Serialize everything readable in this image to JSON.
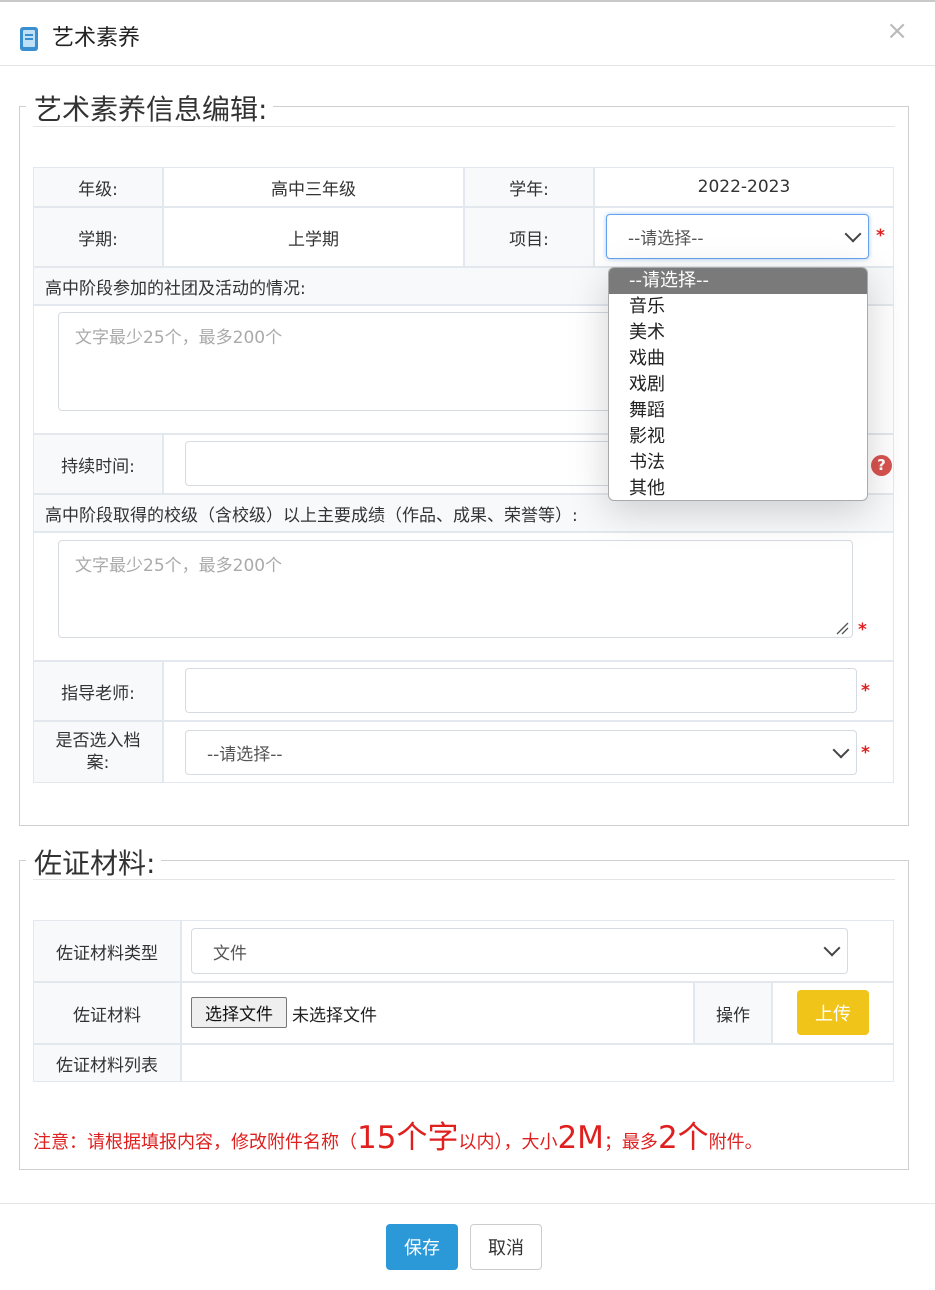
{
  "dialog": {
    "title": "艺术素养",
    "close_label": "×"
  },
  "section1": {
    "legend": "艺术素养信息编辑:",
    "grade_label": "年级:",
    "grade_value": "高中三年级",
    "year_label": "学年:",
    "year_value": "2022-2023",
    "term_label": "学期:",
    "term_value": "上学期",
    "project_label": "项目:",
    "project_selected": "--请选择--",
    "project_options": [
      "--请选择--",
      "音乐",
      "美术",
      "戏曲",
      "戏剧",
      "舞蹈",
      "影视",
      "书法",
      "其他"
    ],
    "activities_label": "高中阶段参加的社团及活动的情况:",
    "activities_placeholder": "文字最少25个，最多200个",
    "duration_label": "持续时间:",
    "achievements_label": "高中阶段取得的校级（含校级）以上主要成绩（作品、成果、荣誉等）:",
    "achievements_placeholder": "文字最少25个，最多200个",
    "teacher_label": "指导老师:",
    "archive_label_line1": "是否选入档",
    "archive_label_line2": "案:",
    "archive_selected": "--请选择--",
    "required_mark": "*",
    "help_mark": "?"
  },
  "section2": {
    "legend": "佐证材料:",
    "type_label": "佐证材料类型",
    "type_selected": "文件",
    "material_label": "佐证材料",
    "choose_file_label": "选择文件",
    "no_file_label": "未选择文件",
    "operation_label": "操作",
    "upload_label": "上传",
    "list_label": "佐证材料列表"
  },
  "notice": {
    "part1": "注意：请根据填报内容，修改附件名称（",
    "big1": "15个字",
    "part2": "以内），大小",
    "big2": "2M",
    "part3": "；最多",
    "big3": "2个",
    "part4": "附件。"
  },
  "footer": {
    "save_label": "保存",
    "cancel_label": "取消"
  },
  "colors": {
    "save": "#2b98d8",
    "upload": "#f0c419",
    "required": "#e02020",
    "help": "#d9534f"
  }
}
